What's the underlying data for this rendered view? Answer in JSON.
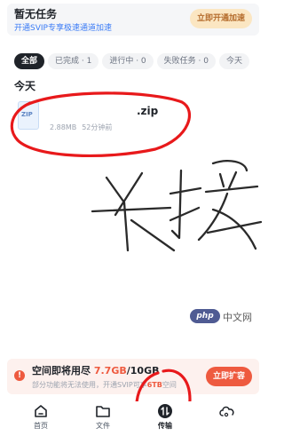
{
  "status": {
    "title": "暂无任务",
    "subtitle": "开通SVIP专享极速通道加速",
    "svip_button": "立即开通加速"
  },
  "filters": [
    {
      "label": "全部",
      "active": true
    },
    {
      "label": "已完成 · 1",
      "active": false
    },
    {
      "label": "进行中 · 0",
      "active": false
    },
    {
      "label": "失败任务 · 0",
      "active": false
    },
    {
      "label": "今天",
      "active": false
    }
  ],
  "section": {
    "date_label": "今天"
  },
  "file": {
    "icon_label": "ZIP",
    "name": ".zip",
    "size": "2.88MB",
    "time": "52分钟前"
  },
  "handwriting": {
    "text": "长按"
  },
  "watermark": {
    "logo": "php",
    "text": "中文网"
  },
  "space": {
    "title_prefix": "空间即将用尽",
    "used": "7.7GB",
    "total": "/10GB",
    "subtitle_prefix": "部分功能将无法使用，开通SVIP可享",
    "highlight": "6TB",
    "subtitle_suffix": "空间"
  },
  "space_button": "立即扩容",
  "tabs": [
    {
      "label": "首页",
      "icon": "home-icon",
      "active": false
    },
    {
      "label": "文件",
      "icon": "folder-icon",
      "active": false
    },
    {
      "label": "传输",
      "icon": "transfer-icon",
      "active": true
    },
    {
      "label": "",
      "icon": "cloud-icon",
      "active": false
    }
  ],
  "colors": {
    "accent_red": "#ee5a3f",
    "link_blue": "#3a7bf6",
    "gold": "#b46b2b",
    "annotation_red": "#e8191b"
  }
}
